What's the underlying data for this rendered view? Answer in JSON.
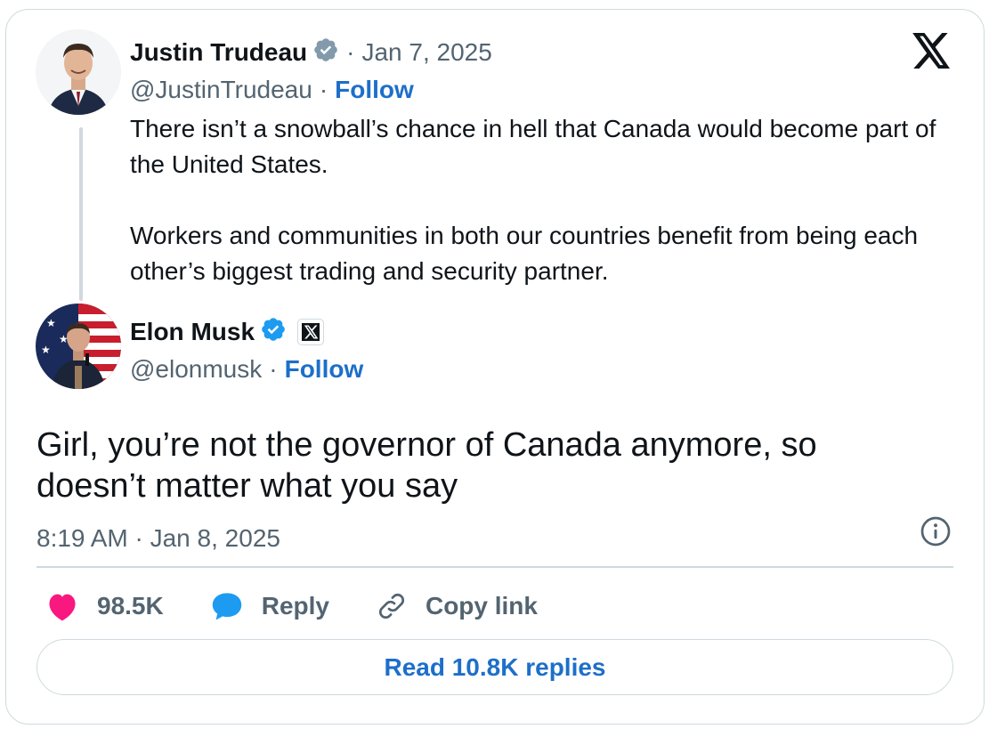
{
  "parent_tweet": {
    "author_name": "Justin Trudeau",
    "date": "Jan 7, 2025",
    "handle": "@JustinTrudeau",
    "follow_label": "Follow",
    "paragraphs": [
      "There isn’t a snowball’s chance in hell that Canada would become part of the United States.",
      "Workers and communities in both our countries benefit from being each other’s biggest trading and security partner."
    ],
    "verified_badge": "gray-verified-icon"
  },
  "tweet": {
    "author_name": "Elon Musk",
    "handle": "@elonmusk",
    "follow_label": "Follow",
    "text": "Girl, you’re not the governor of Canada anymore, so doesn’t matter what you say",
    "timestamp": "8:19 AM · Jan 8, 2025",
    "verified_badge": "blue-verified-icon",
    "affiliate_badge": "x-logo-icon"
  },
  "separator": "·",
  "actions": {
    "like_count": "98.5K",
    "reply_label": "Reply",
    "copy_link_label": "Copy link"
  },
  "read_replies_label": "Read 10.8K replies",
  "icons": {
    "brand": "x-logo-icon",
    "info": "info-icon",
    "like": "heart-icon",
    "reply": "speech-bubble-icon",
    "copy": "link-icon"
  },
  "colors": {
    "link_blue": "#1d6fc9",
    "verified_blue": "#1d9bf0",
    "heart_pink": "#f91880",
    "muted_text": "#536471",
    "border": "#cfd9de"
  }
}
